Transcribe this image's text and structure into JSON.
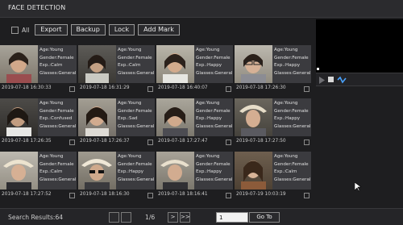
{
  "title": "FACE DETECTION",
  "toolbar": {
    "all_label": "All",
    "buttons": [
      "Export",
      "Backup",
      "Lock",
      "Add Mark"
    ]
  },
  "cards": [
    {
      "age": "Age:Young",
      "gender": "Gender:Female",
      "exp": "Exp.:Calm",
      "glasses": "Glasses:General",
      "time": "2019-07-18 16:30:33"
    },
    {
      "age": "Age:Young",
      "gender": "Gender:Female",
      "exp": "Exp.:Calm",
      "glasses": "Glasses:General",
      "time": "2019-07-18 16:31:29"
    },
    {
      "age": "Age:Young",
      "gender": "Gender:Female",
      "exp": "Exp.:Happy",
      "glasses": "Glasses:General",
      "time": "2019-07-18 16:40:07"
    },
    {
      "age": "Age:Young",
      "gender": "Gender:Female",
      "exp": "Exp.:Happy",
      "glasses": "Glasses:General",
      "time": "2019-07-18 17:26:30"
    },
    {
      "age": "Age:Young",
      "gender": "Gender:Female",
      "exp": "Exp.:Confused",
      "glasses": "Glasses:General",
      "time": "2019-07-18 17:26:35"
    },
    {
      "age": "Age:Young",
      "gender": "Gender:Female",
      "exp": "Exp.:Sad",
      "glasses": "Glasses:General",
      "time": "2019-07-18 17:26:37"
    },
    {
      "age": "Age:Young",
      "gender": "Gender:Female",
      "exp": "Exp.:Happy",
      "glasses": "Glasses:General",
      "time": "2019-07-18 17:27:47"
    },
    {
      "age": "Age:Young",
      "gender": "Gender:Female",
      "exp": "Exp.:Happy",
      "glasses": "Glasses:General",
      "time": "2019-07-18 17:27:50"
    },
    {
      "age": "Age:Young",
      "gender": "Gender:Female",
      "exp": "Exp.:Calm",
      "glasses": "Glasses:General",
      "time": "2019-07-18 17:27:52"
    },
    {
      "age": "Age:Young",
      "gender": "Gender:Female",
      "exp": "Exp.:Happy",
      "glasses": "Glasses:General",
      "time": "2019-07-18 18:16:30"
    },
    {
      "age": "Age:Young",
      "gender": "Gender:Female",
      "exp": "Exp.:Happy",
      "glasses": "Glasses:General",
      "time": "2019-07-18 18:16:41"
    },
    {
      "age": "Age:Young",
      "gender": "Gender:Female",
      "exp": "Exp.:Calm",
      "glasses": "Glasses:General",
      "time": "2019-07-19 10:03:19"
    }
  ],
  "footer": {
    "search_results": "Search Results:64",
    "page_indicator": "1/6",
    "page_value": "1",
    "goto_label": "Go To",
    "next": ">",
    "last": ">>"
  },
  "colors": {
    "background": "#1e1e20",
    "panel": "#3b3b3f",
    "accent_blue": "#4aa3ff"
  }
}
